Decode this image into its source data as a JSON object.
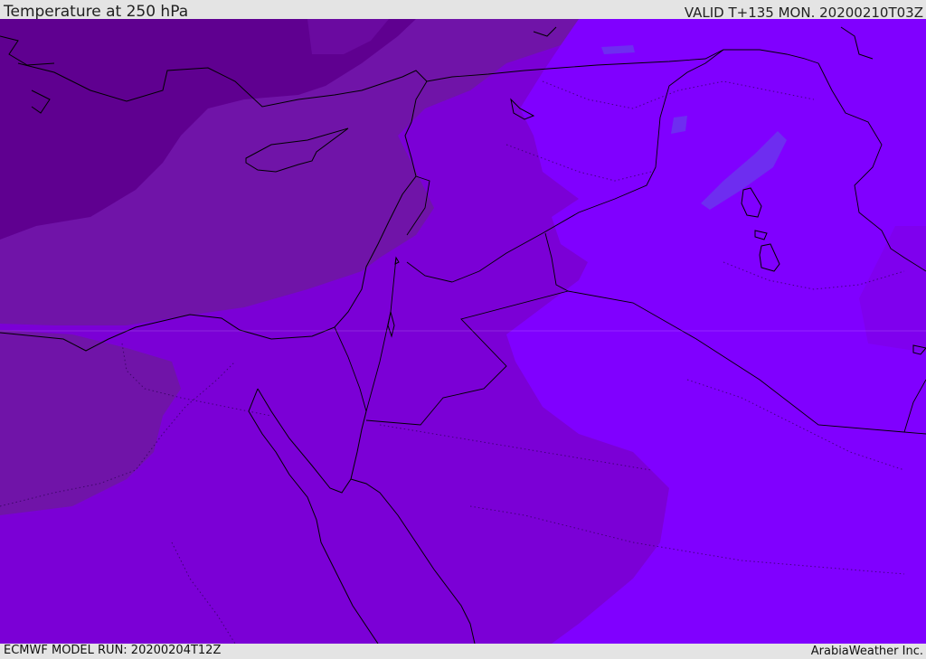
{
  "header": {
    "title": "Temperature at 250 hPa",
    "valid_time": "VALID T+135 MON. 20200210T03Z"
  },
  "footer": {
    "model_run": "ECMWF MODEL RUN: 20200204T12Z",
    "credit": "ArabiaWeather Inc."
  },
  "colors": {
    "coldest": "#5f0090",
    "cold": "#7014a8",
    "mid": "#7b00d6",
    "warm": "#7f00ee",
    "warmest": "#8000ff",
    "pocket": "#6e2df0",
    "border_lines": "#000000"
  }
}
